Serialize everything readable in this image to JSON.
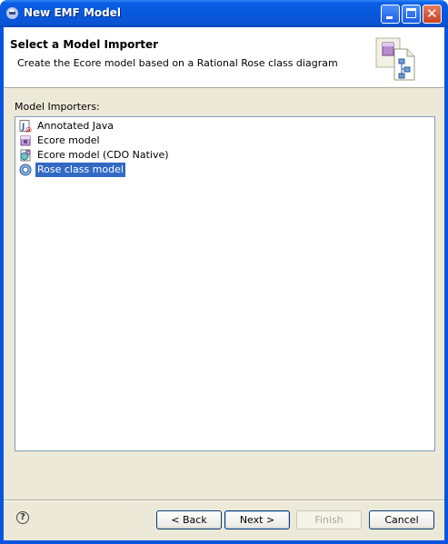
{
  "window": {
    "title": "New EMF Model"
  },
  "header": {
    "title": "Select a Model Importer",
    "description": "Create the Ecore model based on a Rational Rose class diagram"
  },
  "importers": {
    "label": "Model Importers:",
    "items": [
      {
        "label": "Annotated Java",
        "icon": "java-annotation-icon"
      },
      {
        "label": "Ecore model",
        "icon": "ecore-icon"
      },
      {
        "label": "Ecore model (CDO Native)",
        "icon": "ecore-cdo-icon"
      },
      {
        "label": "Rose class model",
        "icon": "rose-model-icon",
        "selected": true
      }
    ]
  },
  "buttons": {
    "help": "?",
    "back": "< Back",
    "next": "Next >",
    "finish": "Finish",
    "cancel": "Cancel"
  },
  "colors": {
    "titlebar": "#0858dd",
    "selection": "#316ac5",
    "dialog_bg": "#ece9d8"
  }
}
